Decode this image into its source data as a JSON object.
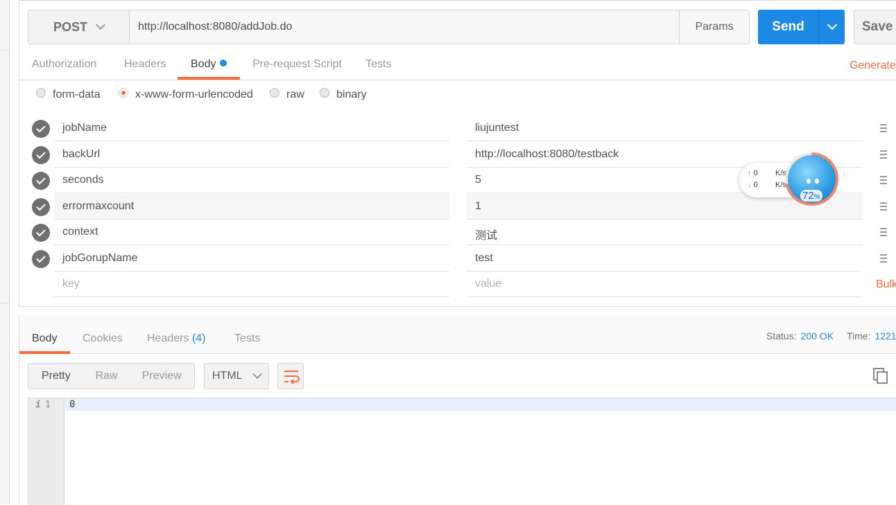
{
  "request": {
    "method": "POST",
    "url": "http://localhost:8080/addJob.do",
    "params_label": "Params",
    "send_label": "Send",
    "save_label": "Save"
  },
  "request_tabs": {
    "authorization": "Authorization",
    "headers": "Headers",
    "body": "Body",
    "prerequest": "Pre-request Script",
    "tests": "Tests",
    "generate": "Generate"
  },
  "body_types": {
    "form_data": "form-data",
    "urlencoded": "x-www-form-urlencoded",
    "raw": "raw",
    "binary": "binary",
    "selected": "x-www-form-urlencoded"
  },
  "params": [
    {
      "key": "jobName",
      "value": "liujuntest"
    },
    {
      "key": "backUrl",
      "value": "http://localhost:8080/testback"
    },
    {
      "key": "seconds",
      "value": "5"
    },
    {
      "key": "errormaxcount",
      "value": "1"
    },
    {
      "key": "context",
      "value": "测试"
    },
    {
      "key": "jobGorupName",
      "value": "test"
    }
  ],
  "placeholder_row": {
    "key": "key",
    "value": "value"
  },
  "bulk_label": "Bulk",
  "net_widget": {
    "up_value": "0",
    "down_value": "0",
    "unit": "K/s",
    "percent": "72",
    "percent_sign": "%"
  },
  "response": {
    "tabs": {
      "body": "Body",
      "cookies": "Cookies",
      "headers": "Headers",
      "headers_count": "(4)",
      "tests": "Tests"
    },
    "status_label": "Status:",
    "status_value": "200 OK",
    "time_label": "Time:",
    "time_value": "1221",
    "formats": {
      "pretty": "Pretty",
      "raw": "Raw",
      "preview": "Preview"
    },
    "language": "HTML",
    "line_number": "1",
    "line_content": "0"
  },
  "colors": {
    "accent": "#f26b3a",
    "primary": "#1e88e5"
  }
}
